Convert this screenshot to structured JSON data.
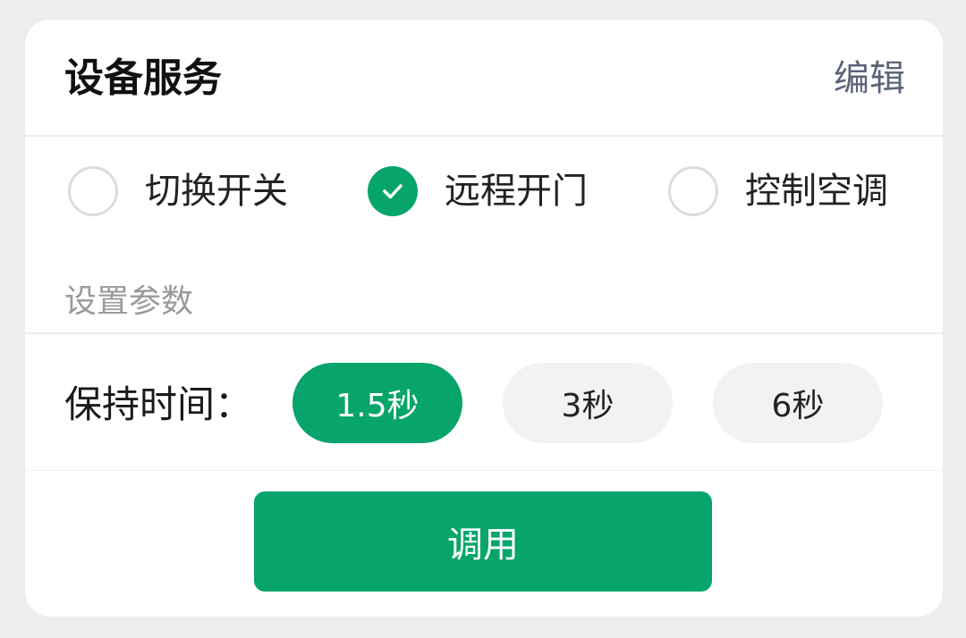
{
  "header": {
    "title": "设备服务",
    "edit_label": "编辑"
  },
  "services": [
    {
      "label": "切换开关",
      "checked": false
    },
    {
      "label": "远程开门",
      "checked": true
    },
    {
      "label": "控制空调",
      "checked": false
    }
  ],
  "params": {
    "section_label": "设置参数",
    "hold_time_label": "保持时间：",
    "hold_options": [
      {
        "label": "1.5秒",
        "selected": true
      },
      {
        "label": "3秒",
        "selected": false
      },
      {
        "label": "6秒",
        "selected": false
      }
    ]
  },
  "action": {
    "invoke_label": "调用"
  },
  "colors": {
    "accent": "#07a46b",
    "background": "#ededed",
    "card": "#ffffff",
    "edit_text": "#5b6478",
    "muted_text": "#9a9a9a",
    "chip_inactive": "#f2f2f2"
  }
}
